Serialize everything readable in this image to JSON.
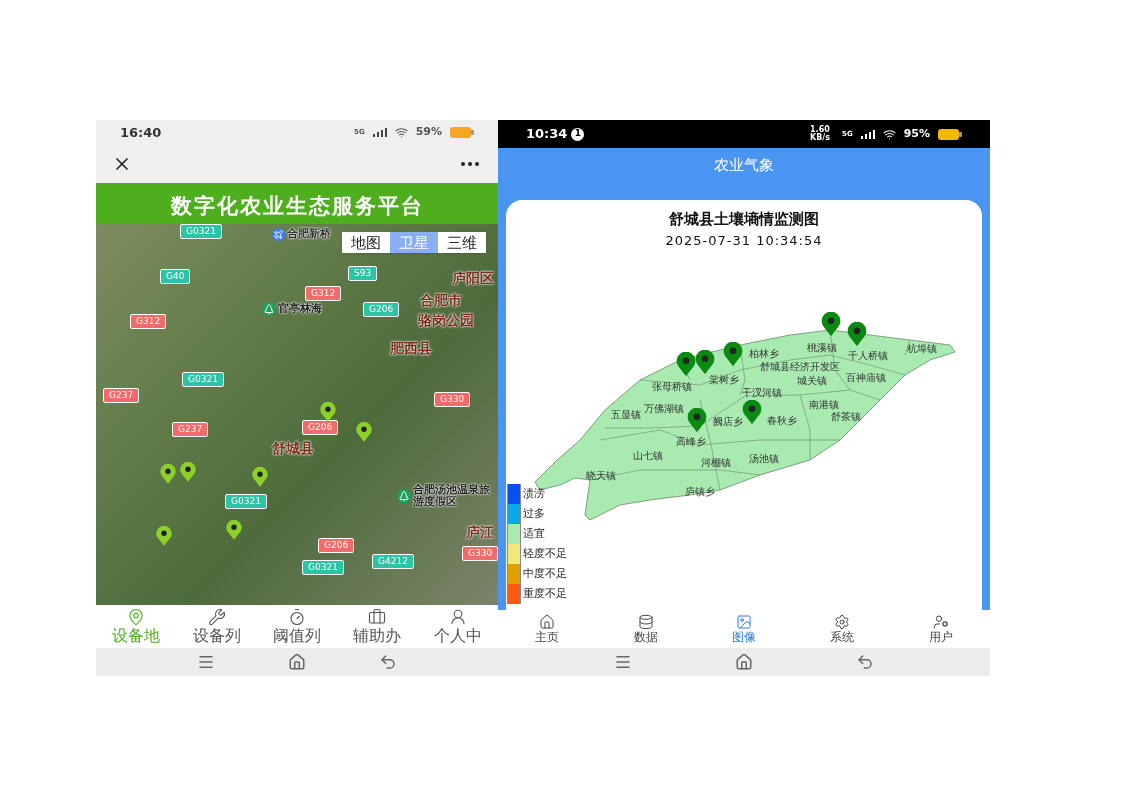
{
  "left_phone": {
    "status_bar": {
      "time": "16:40",
      "network": "5G",
      "battery": "59%"
    },
    "header_title": "数字化农业生态服务平台",
    "map": {
      "layer_switch": [
        {
          "label": "地图",
          "selected": false
        },
        {
          "label": "卫星",
          "selected": true
        },
        {
          "label": "三维",
          "selected": false
        }
      ],
      "labels": [
        {
          "text": "G0321",
          "kind": "road",
          "color": "#2cc4a4"
        },
        {
          "text": "合肥新桥",
          "kind": "airport"
        },
        {
          "text": "G40",
          "kind": "road",
          "color": "#2cc4a4"
        },
        {
          "text": "S93",
          "kind": "road",
          "color": "#2cc4a4"
        },
        {
          "text": "庐阳区",
          "kind": "place"
        },
        {
          "text": "G312",
          "kind": "road",
          "color": "#f26a6a"
        },
        {
          "text": "合肥市",
          "kind": "place"
        },
        {
          "text": "G312",
          "kind": "road",
          "color": "#f26a6a"
        },
        {
          "text": "官亭林海",
          "kind": "poi"
        },
        {
          "text": "G206",
          "kind": "road",
          "color": "#2cc4a4"
        },
        {
          "text": "骆岗公园",
          "kind": "place"
        },
        {
          "text": "肥西县",
          "kind": "place"
        },
        {
          "text": "G0321",
          "kind": "road",
          "color": "#2cc4a4"
        },
        {
          "text": "G237",
          "kind": "road",
          "color": "#f26a6a"
        },
        {
          "text": "G330",
          "kind": "road",
          "color": "#f26a6a"
        },
        {
          "text": "G237",
          "kind": "road",
          "color": "#f26a6a"
        },
        {
          "text": "G206",
          "kind": "road",
          "color": "#f26a6a"
        },
        {
          "text": "舒城县",
          "kind": "place"
        },
        {
          "text": "G0321",
          "kind": "road",
          "color": "#2cc4a4"
        },
        {
          "text": "合肥汤池温泉旅游度假区",
          "kind": "poi"
        },
        {
          "text": "庐江",
          "kind": "place"
        },
        {
          "text": "G206",
          "kind": "road",
          "color": "#f26a6a"
        },
        {
          "text": "G330",
          "kind": "road",
          "color": "#f26a6a"
        },
        {
          "text": "G4212",
          "kind": "road",
          "color": "#2cc4a4"
        },
        {
          "text": "G0321",
          "kind": "road",
          "color": "#2cc4a4"
        }
      ]
    },
    "bottom_nav": [
      {
        "label": "设备地",
        "selected": true
      },
      {
        "label": "设备列",
        "selected": false
      },
      {
        "label": "阈值列",
        "selected": false
      },
      {
        "label": "辅助办",
        "selected": false
      },
      {
        "label": "个人中",
        "selected": false
      }
    ]
  },
  "right_phone": {
    "status_bar": {
      "time": "10:34",
      "notification_count": "1",
      "speed": "1.60 KB/s",
      "network": "5G",
      "battery": "95%"
    },
    "header_title": "农业气象",
    "card": {
      "title": "舒城县土壤墒情监测图",
      "timestamp": "2025-07-31 10:34:54",
      "towns": [
        "桃溪镇",
        "千人桥镇",
        "杭埠镇",
        "柏林乡",
        "舒城县经济开发区",
        "张母桥镇",
        "棠树乡",
        "干汊河镇",
        "城关镇",
        "百神庙镇",
        "南港镇",
        "五显镇",
        "万佛湖镇",
        "阙店乡",
        "春秋乡",
        "舒茶镇",
        "高峰乡",
        "山七镇",
        "河棚镇",
        "汤池镇",
        "晓天镇",
        "庐镇乡"
      ],
      "legend": [
        {
          "label": "渍涝",
          "color": "#0a50f0"
        },
        {
          "label": "过多",
          "color": "#08a8e8"
        },
        {
          "label": "适宜",
          "color": "#a8eab0"
        },
        {
          "label": "轻度不足",
          "color": "#f0e878"
        },
        {
          "label": "中度不足",
          "color": "#e0a000"
        },
        {
          "label": "重度不足",
          "color": "#ff5a10"
        }
      ]
    },
    "bottom_nav": [
      {
        "label": "主页",
        "selected": false
      },
      {
        "label": "数据",
        "selected": false
      },
      {
        "label": "图像",
        "selected": true
      },
      {
        "label": "系统",
        "selected": false
      },
      {
        "label": "用户",
        "selected": false
      }
    ]
  }
}
